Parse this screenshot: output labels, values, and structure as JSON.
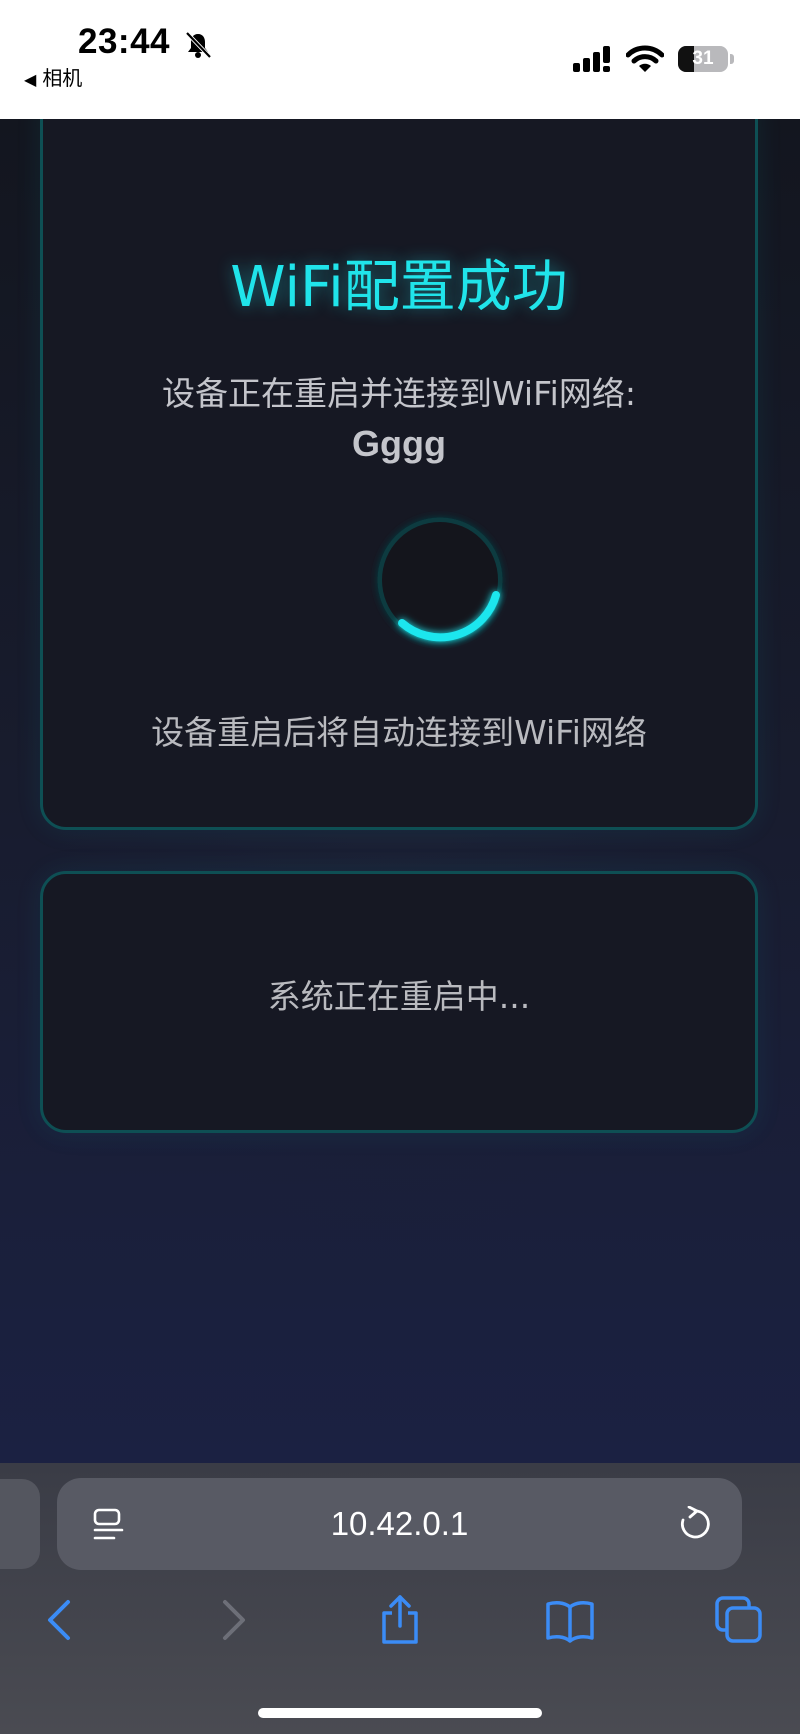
{
  "status_bar": {
    "time": "23:44",
    "back_label": "相机",
    "battery_level": "31",
    "battery_percent": 31
  },
  "page": {
    "title": "WiFi配置成功",
    "message": "设备正在重启并连接到WiFi网络:",
    "ssid": "Gggg",
    "sub_message": "设备重启后将自动连接到WiFi网络",
    "system_status": "系统正在重启中...",
    "accent_color": "#20e4ea"
  },
  "browser": {
    "url": "10.42.0.1",
    "icons": [
      "page-menu-icon",
      "reload-icon",
      "back-icon",
      "forward-icon",
      "share-icon",
      "bookmarks-icon",
      "tabs-icon"
    ]
  }
}
